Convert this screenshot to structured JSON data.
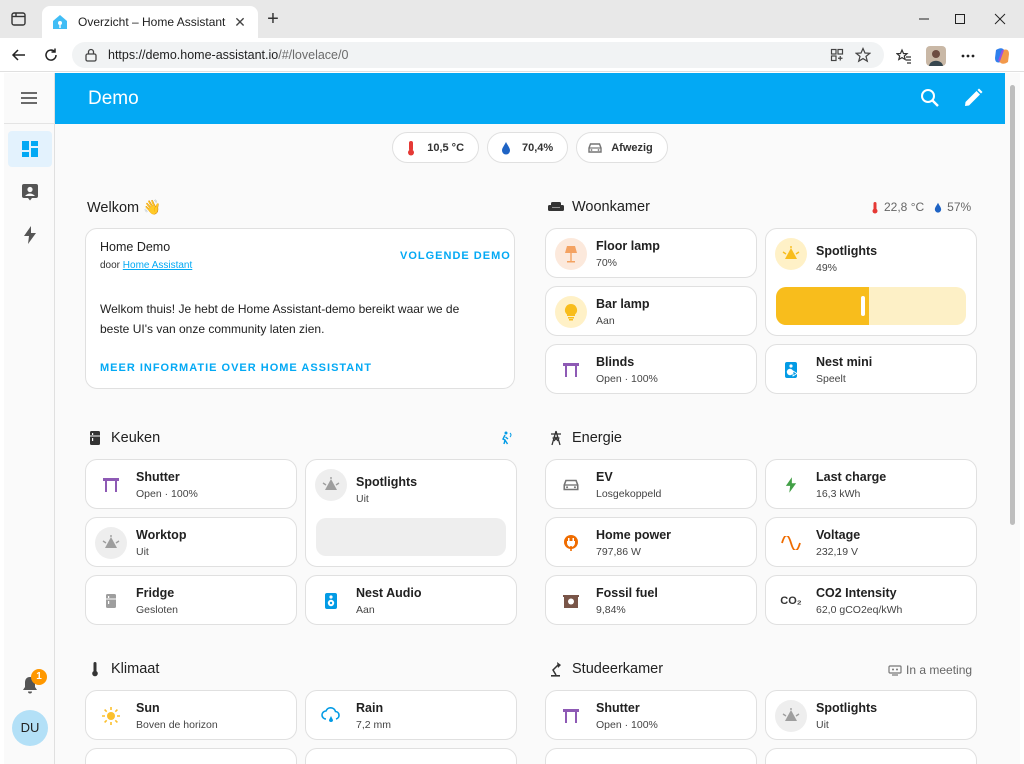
{
  "browser": {
    "tab_title": "Overzicht – Home Assistant",
    "url_host": "https://demo.home-assistant.io",
    "url_path": "/#/lovelace/0"
  },
  "header": {
    "title": "Demo"
  },
  "sidebar": {
    "notification_count": "1",
    "avatar_initials": "DU"
  },
  "badges": [
    {
      "value": "10,5 °C",
      "icon": "thermometer-icon",
      "color": "#e53935"
    },
    {
      "value": "70,4%",
      "icon": "water-drop-icon",
      "color": "#1e63c4"
    },
    {
      "value": "Afwezig",
      "icon": "car-icon",
      "color": "#757575"
    }
  ],
  "welcome": {
    "title": "Welkom 👋",
    "card_title": "Home Demo",
    "byline": "door",
    "byline_link": "Home Assistant",
    "next_demo": "VOLGENDE DEMO",
    "body": "Welkom thuis! Je hebt de Home Assistant-demo bereikt waar we de beste UI's van onze community laten zien.",
    "more_info": "MEER INFORMATIE OVER HOME ASSISTANT"
  },
  "woonkamer": {
    "title": "Woonkamer",
    "temperature": "22,8 °C",
    "humidity": "57%",
    "tiles": [
      {
        "name": "Floor lamp",
        "state": "70%"
      },
      {
        "name": "Bar lamp",
        "state": "Aan"
      },
      {
        "name": "Blinds",
        "state": "Open · 100%"
      },
      {
        "name": "Spotlights",
        "state": "49%"
      },
      {
        "name": "Nest mini",
        "state": "Speelt"
      }
    ],
    "spotlights_brightness": 0.49
  },
  "keuken": {
    "title": "Keuken",
    "tiles": [
      {
        "name": "Shutter",
        "state": "Open · 100%"
      },
      {
        "name": "Worktop",
        "state": "Uit"
      },
      {
        "name": "Fridge",
        "state": "Gesloten"
      },
      {
        "name": "Spotlights",
        "state": "Uit"
      },
      {
        "name": "Nest Audio",
        "state": "Aan"
      }
    ]
  },
  "energie": {
    "title": "Energie",
    "tiles": [
      {
        "name": "EV",
        "state": "Losgekoppeld"
      },
      {
        "name": "Home power",
        "state": "797,86 W"
      },
      {
        "name": "Fossil fuel",
        "state": "9,84%"
      },
      {
        "name": "Last charge",
        "state": "16,3 kWh"
      },
      {
        "name": "Voltage",
        "state": "232,19 V"
      },
      {
        "name": "CO2 Intensity",
        "state": "62,0 gCO2eq/kWh"
      }
    ],
    "co2_icon_text": "CO₂"
  },
  "klimaat": {
    "title": "Klimaat",
    "tiles": [
      {
        "name": "Sun",
        "state": "Boven de horizon"
      },
      {
        "name": "Rain",
        "state": "7,2 mm"
      }
    ]
  },
  "studeerkamer": {
    "title": "Studeerkamer",
    "status": "In a meeting",
    "tiles": [
      {
        "name": "Shutter",
        "state": "Open · 100%"
      },
      {
        "name": "Spotlights",
        "state": "Uit"
      }
    ]
  }
}
